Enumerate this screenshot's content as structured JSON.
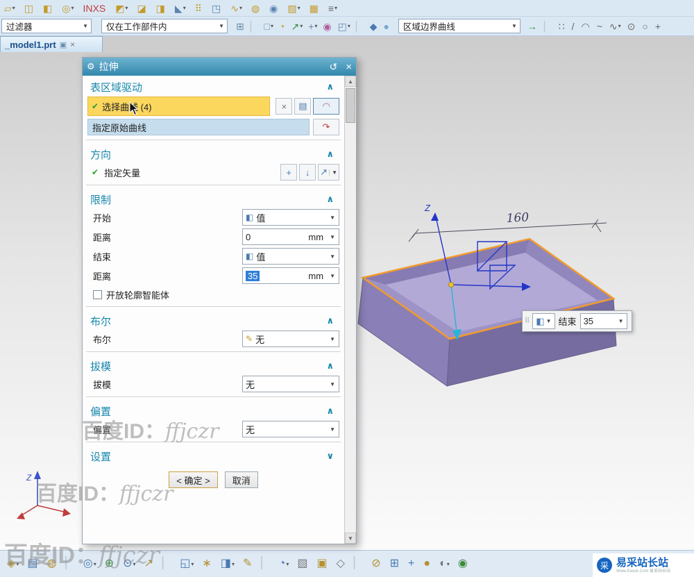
{
  "ui": {
    "dd": "▼",
    "dds": "▾",
    "up": "▲",
    "down": "▼",
    "grip": "⠿"
  },
  "tab": {
    "title": "_model1.prt",
    "state_glyph": "▣",
    "close_glyph": "×"
  },
  "toolbar_top": {
    "icons": [
      {
        "n": "sketch-icon",
        "g": "▱",
        "c": "#c49a2a",
        "dd": "▾"
      },
      {
        "n": "datum-plane-icon",
        "g": "◫",
        "c": "#c49a2a",
        "dd": ""
      },
      {
        "n": "extrude-icon",
        "g": "◧",
        "c": "#c49a2a",
        "dd": ""
      },
      {
        "n": "revolve-icon",
        "g": "◎",
        "c": "#c49a2a",
        "dd": "▾"
      },
      {
        "n": "inxs-icon",
        "g": "INXS",
        "c": "#c23b3b",
        "dd": ""
      },
      {
        "n": "unite-icon",
        "g": "◩",
        "c": "#c49a2a",
        "dd": "▾"
      },
      {
        "n": "edge-blend-icon",
        "g": "◪",
        "c": "#c49a2a",
        "dd": ""
      },
      {
        "n": "shell-icon",
        "g": "◨",
        "c": "#c49a2a",
        "dd": ""
      },
      {
        "n": "chamfer-icon",
        "g": "◣",
        "c": "#5b84b1",
        "dd": "▾"
      },
      {
        "n": "pattern-feature-icon",
        "g": "⠿",
        "c": "#c49a2a",
        "dd": ""
      },
      {
        "n": "mirror-feature-icon",
        "g": "◳",
        "c": "#5b84b1",
        "dd": ""
      },
      {
        "n": "sweep-icon",
        "g": "∿",
        "c": "#c49a2a",
        "dd": "▾"
      },
      {
        "n": "tube-icon",
        "g": "◍",
        "c": "#c49a2a",
        "dd": ""
      },
      {
        "n": "hole-icon",
        "g": "◉",
        "c": "#5b84b1",
        "dd": ""
      },
      {
        "n": "boss-icon",
        "g": "▨",
        "c": "#c49a2a",
        "dd": "▾"
      },
      {
        "n": "rib-icon",
        "g": "▦",
        "c": "#c49a2a",
        "dd": ""
      },
      {
        "n": "more-commands-icon",
        "g": "≡",
        "c": "#666666",
        "dd": "▾"
      }
    ]
  },
  "toolbar_second": {
    "filter_combo": "过滤器",
    "scope_combo": "仅在工作部件内",
    "curve_rule_combo": "区域边界曲线",
    "mid_icons": [
      {
        "n": "snap-grid-icon",
        "g": "⊞",
        "c": "#6b8cab",
        "dd": ""
      },
      {
        "n": "separator",
        "g": "▏",
        "c": "#b9c8d8",
        "dd": ""
      },
      {
        "n": "select-scope-icon",
        "g": "□",
        "c": "#6b8cab",
        "dd": "▾"
      },
      {
        "n": "highlight-icon",
        "g": "◔",
        "c": "#c49a2a",
        "dd": ""
      },
      {
        "n": "top-selection-icon",
        "g": "↗",
        "c": "#3a8a3a",
        "dd": "▾"
      },
      {
        "n": "snap-point-icon",
        "g": "+",
        "c": "#6b8cab",
        "dd": "▾"
      },
      {
        "n": "point-on-curve-icon",
        "g": "◉",
        "c": "#b05b9a",
        "dd": ""
      },
      {
        "n": "rect-select-icon",
        "g": "◰",
        "c": "#6b8cab",
        "dd": "▾"
      },
      {
        "n": "separator",
        "g": "▏",
        "c": "#b9c8d8",
        "dd": ""
      },
      {
        "n": "shaded-cube-icon",
        "g": "◆",
        "c": "#4a7ab0",
        "dd": ""
      },
      {
        "n": "sphere-display-icon",
        "g": "●",
        "c": "#7aa7d6",
        "dd": ""
      }
    ],
    "right_icons": [
      {
        "n": "apply-rule-icon",
        "g": "→",
        "c": "#3a8a3a",
        "dd": ""
      },
      {
        "n": "separator",
        "g": "▏",
        "c": "#b9c8d8",
        "dd": ""
      },
      {
        "n": "point-dots-icon",
        "g": "∷",
        "c": "#666666",
        "dd": ""
      },
      {
        "n": "line-tool-icon",
        "g": "/",
        "c": "#666666",
        "dd": ""
      },
      {
        "n": "arc-tool-icon",
        "g": "◠",
        "c": "#666666",
        "dd": ""
      },
      {
        "n": "polyline-tool-icon",
        "g": "~",
        "c": "#666666",
        "dd": ""
      },
      {
        "n": "spline-tool-icon",
        "g": "∿",
        "c": "#666666",
        "dd": "▾"
      },
      {
        "n": "circle-center-icon",
        "g": "⊙",
        "c": "#666666",
        "dd": ""
      },
      {
        "n": "circle-tool-icon",
        "g": "○",
        "c": "#666666",
        "dd": ""
      },
      {
        "n": "point-plus-icon",
        "g": "+",
        "c": "#666666",
        "dd": ""
      }
    ]
  },
  "dialog": {
    "title": "拉伸",
    "gear_glyph": "⚙",
    "undo_glyph": "↺",
    "close_glyph": "×",
    "collapse_glyph": "∧",
    "expand_glyph": "∨",
    "value_icon": "◧",
    "region": {
      "title": "表区域驱动",
      "check": "✔",
      "select_curve": "选择曲线 (4)",
      "swap_icon": "×",
      "list_icon": "▤",
      "lasso_icon": "◠",
      "origin_curve": "指定原始曲线",
      "origin_btn_icon": "↷"
    },
    "direction": {
      "title": "方向",
      "check": "✔",
      "specify_vector": "指定矢量",
      "inferred_icon": "+",
      "down_icon": "↓",
      "vector_icon": "↗"
    },
    "limits": {
      "title": "限制",
      "start_label": "开始",
      "start_mode": "值",
      "start_dist_label": "距离",
      "start_dist": "0",
      "start_unit": "mm",
      "end_label": "结束",
      "end_mode": "值",
      "end_dist_label": "距离",
      "end_dist": "35",
      "end_unit": "mm",
      "open_profile": "开放轮廓智能体"
    },
    "boolean": {
      "title": "布尔",
      "row_label": "布尔",
      "value": "无",
      "icon": "✎"
    },
    "draft": {
      "title": "拔模",
      "row_label": "拔模",
      "value": "无"
    },
    "offset": {
      "title": "偏置",
      "row_label": "偏置",
      "value": "无"
    },
    "settings_title": "设置",
    "ok": "< 确定 >",
    "cancel": "取消"
  },
  "viewport": {
    "dimension": "160",
    "z_label": "Z",
    "triad_z": "Z",
    "floating": {
      "mode_glyph": "◧",
      "end_label": "结束",
      "value": "35"
    }
  },
  "bottom_toolbar": {
    "icons": [
      {
        "n": "refresh-view-icon",
        "g": "◈",
        "c": "#b5912f",
        "dd": "▾"
      },
      {
        "n": "layer-settings-icon",
        "g": "▤",
        "c": "#4a7ab0",
        "dd": ""
      },
      {
        "n": "render-style-icon",
        "g": "◍",
        "c": "#b5912f",
        "dd": ""
      },
      {
        "n": "separator",
        "g": "▏",
        "c": "#b9c8d8",
        "dd": ""
      },
      {
        "n": "orient-view-icon",
        "g": "◎",
        "c": "#4a7ab0",
        "dd": "▾"
      },
      {
        "n": "fit-view-icon",
        "g": "⊕",
        "c": "#3a8a3a",
        "dd": ""
      },
      {
        "n": "zoom-icon",
        "g": "⊙",
        "c": "#4a7ab0",
        "dd": "▾"
      },
      {
        "n": "pan-icon",
        "g": "↗",
        "c": "#b5912f",
        "dd": ""
      },
      {
        "n": "separator",
        "g": "▏",
        "c": "#b9c8d8",
        "dd": ""
      },
      {
        "n": "measure-distance-icon",
        "g": "◱",
        "c": "#4a7ab0",
        "dd": "▾"
      },
      {
        "n": "analysis-icon",
        "g": "∗",
        "c": "#b5912f",
        "dd": ""
      },
      {
        "n": "section-view-icon",
        "g": "◨",
        "c": "#4a7ab0",
        "dd": "▾"
      },
      {
        "n": "edit-display-icon",
        "g": "✎",
        "c": "#b5912f",
        "dd": ""
      },
      {
        "n": "separator",
        "g": "▏",
        "c": "#b9c8d8",
        "dd": ""
      },
      {
        "n": "show-hide-icon",
        "g": "◔",
        "c": "#4a7ab0",
        "dd": "▾"
      },
      {
        "n": "wireframe-icon",
        "g": "▧",
        "c": "#777777",
        "dd": ""
      },
      {
        "n": "shaded-icon",
        "g": "▣",
        "c": "#b5912f",
        "dd": ""
      },
      {
        "n": "iso-view-icon",
        "g": "◇",
        "c": "#777777",
        "dd": ""
      },
      {
        "n": "separator",
        "g": "▏",
        "c": "#b9c8d8",
        "dd": ""
      },
      {
        "n": "snap-toggle-icon",
        "g": "⊘",
        "c": "#b5912f",
        "dd": ""
      },
      {
        "n": "grid-toggle-icon",
        "g": "⊞",
        "c": "#4a7ab0",
        "dd": ""
      },
      {
        "n": "wcs-icon",
        "g": "+",
        "c": "#4a7ab0",
        "dd": ""
      },
      {
        "n": "material-icon",
        "g": "●",
        "c": "#b5912f",
        "dd": ""
      },
      {
        "n": "light-icon",
        "g": "◐",
        "c": "#777777",
        "dd": "▾"
      },
      {
        "n": "help-icon",
        "g": "◉",
        "c": "#3a8a3a",
        "dd": ""
      }
    ]
  },
  "watermark": {
    "prefix": "百度ID：",
    "suffix": "ffjczr"
  },
  "badge": {
    "logo": "采",
    "name": "易采站长站",
    "sub": "Www.Easck.Com 易采站长站"
  }
}
